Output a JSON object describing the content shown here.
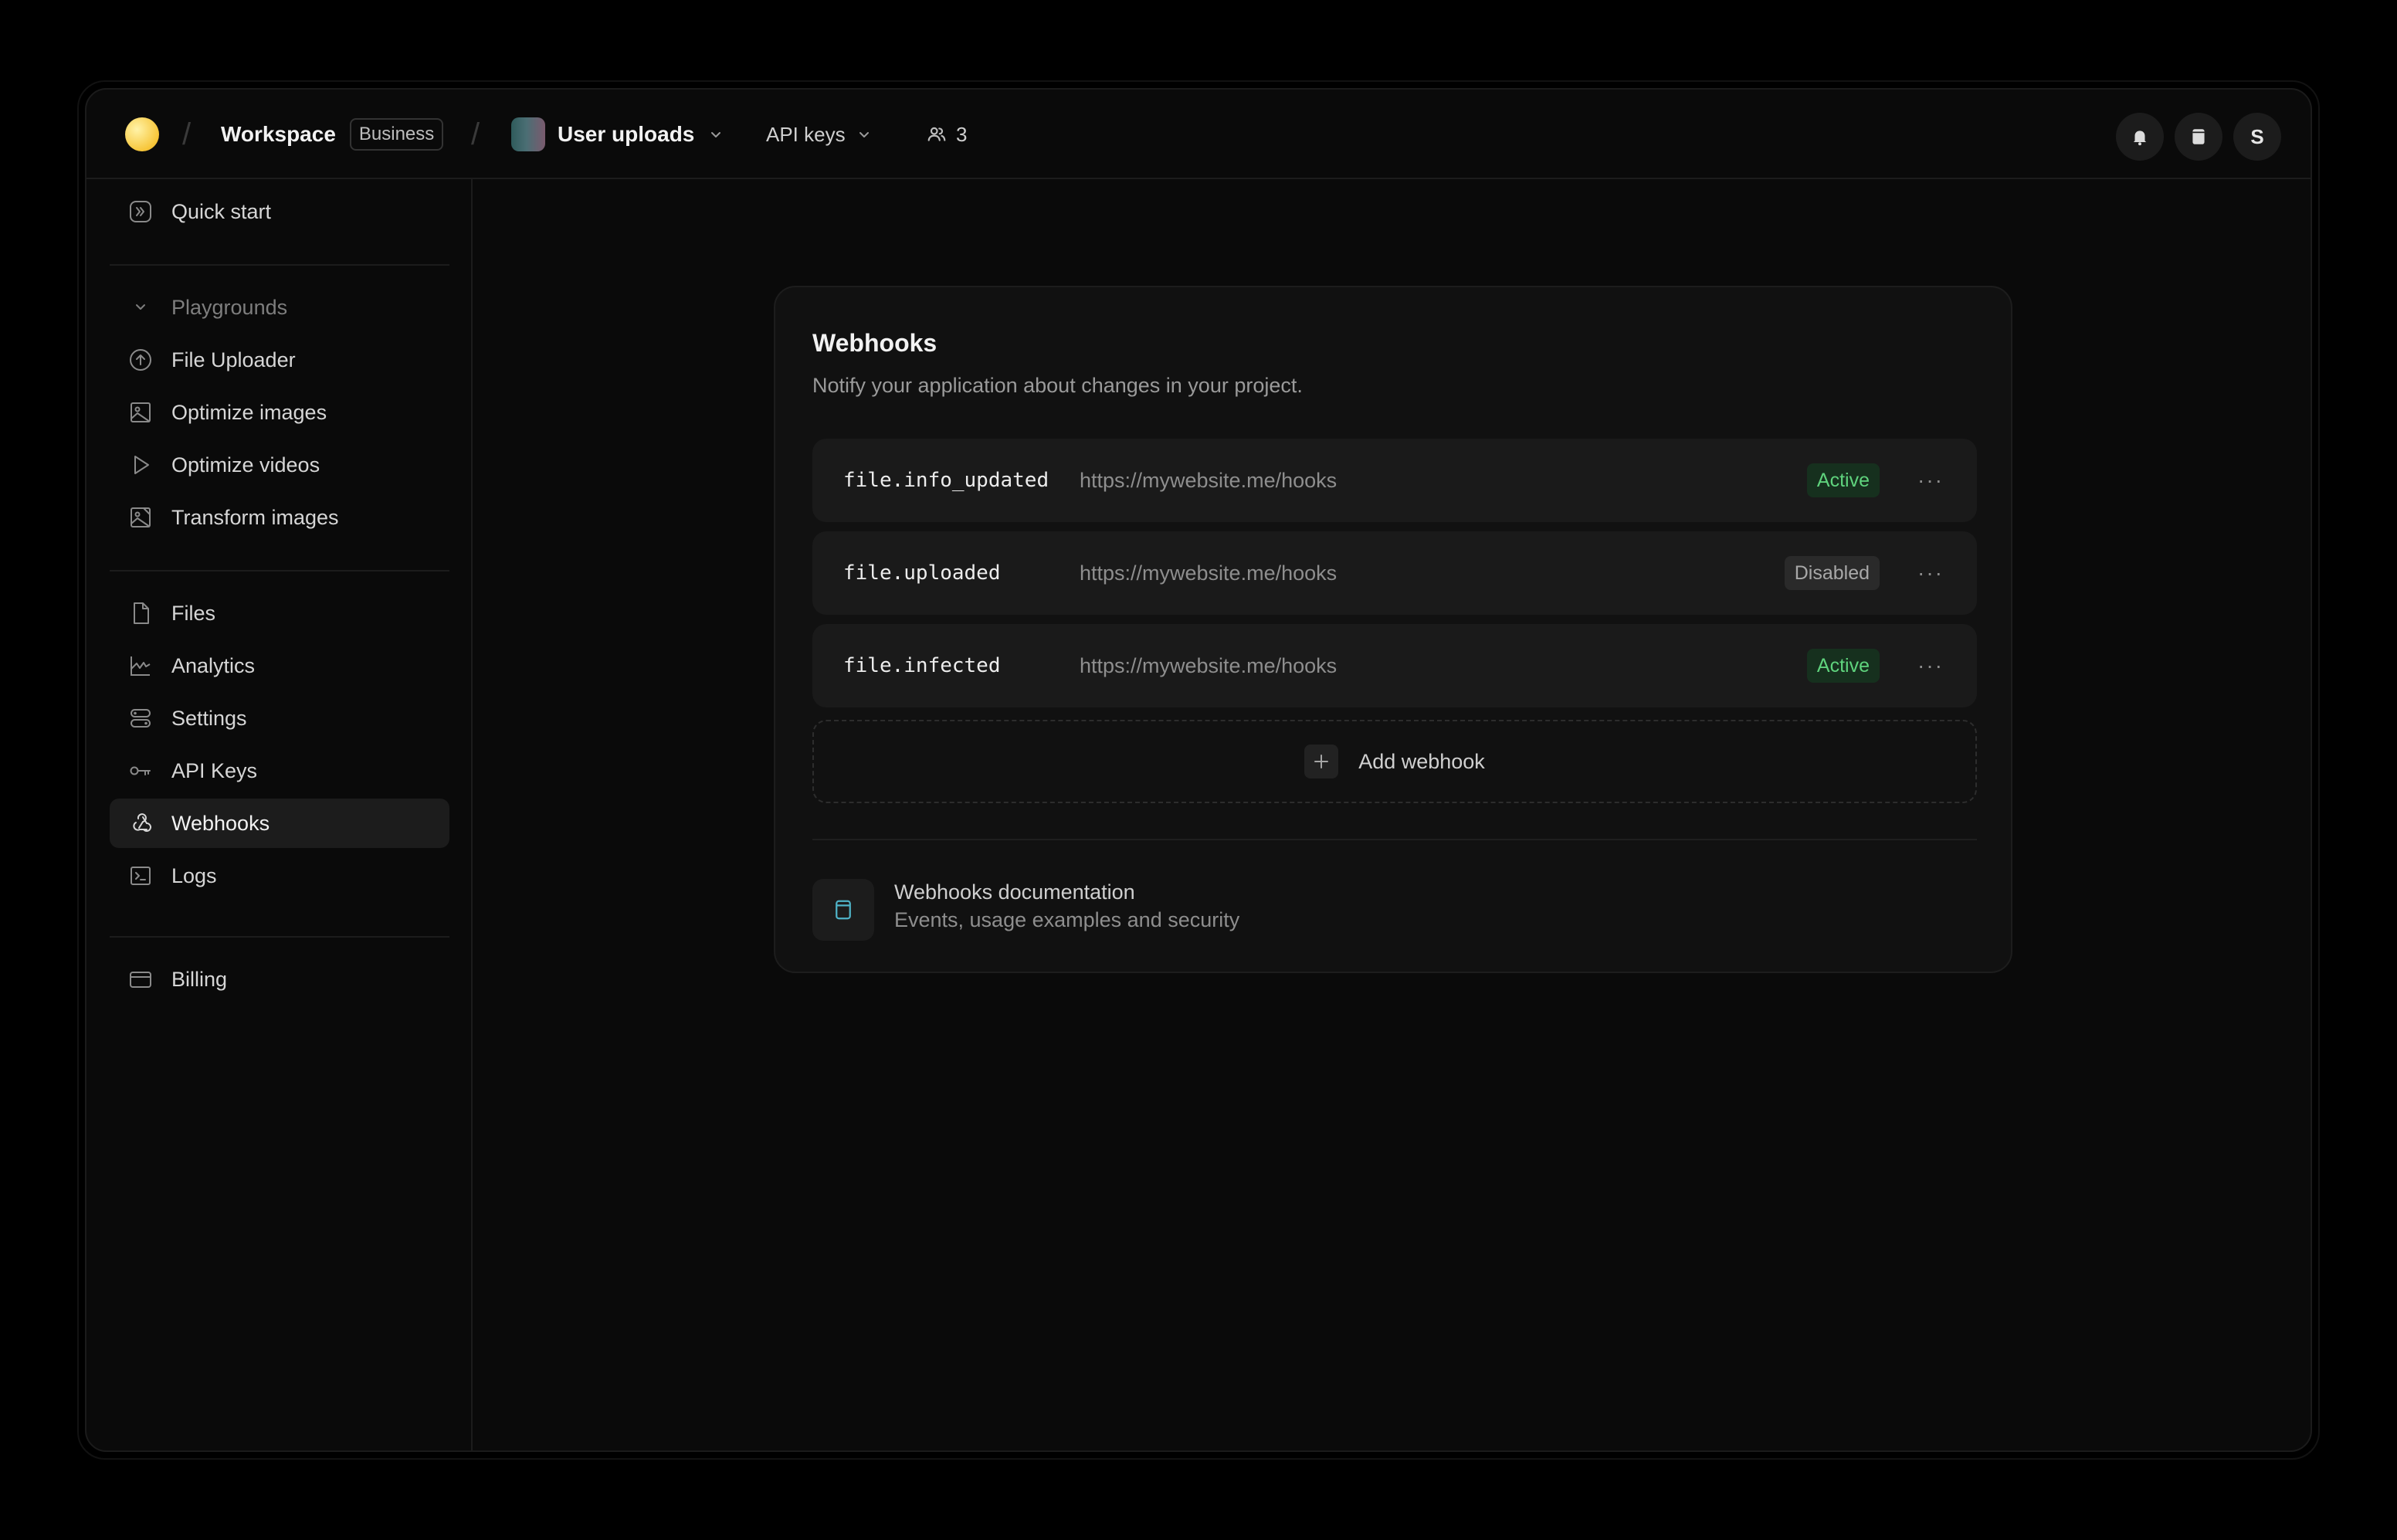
{
  "header": {
    "workspace_name": "Workspace",
    "plan_badge": "Business",
    "project_name": "User uploads",
    "api_keys_label": "API keys",
    "member_count": "3",
    "avatar_initial": "S",
    "icons": [
      "workspace-logo-icon",
      "project-icon",
      "chevron-down-icon",
      "users-icon",
      "bell-icon",
      "book-icon"
    ]
  },
  "sidebar": {
    "quick_start": "Quick start",
    "group_label": "Playgrounds",
    "playgrounds": [
      {
        "label": "File Uploader",
        "icon": "upload-icon"
      },
      {
        "label": "Optimize images",
        "icon": "image-icon"
      },
      {
        "label": "Optimize videos",
        "icon": "play-icon"
      },
      {
        "label": "Transform images",
        "icon": "transform-image-icon"
      }
    ],
    "items": [
      {
        "label": "Files",
        "icon": "file-icon"
      },
      {
        "label": "Analytics",
        "icon": "analytics-icon"
      },
      {
        "label": "Settings",
        "icon": "settings-icon"
      },
      {
        "label": "API Keys",
        "icon": "key-icon"
      },
      {
        "label": "Webhooks",
        "icon": "webhook-icon",
        "active": true
      },
      {
        "label": "Logs",
        "icon": "terminal-icon"
      }
    ],
    "billing": "Billing"
  },
  "webhooks": {
    "title": "Webhooks",
    "subtitle": "Notify your application about changes in your project.",
    "rows": [
      {
        "event": "file.info_updated",
        "url": "https://mywebsite.me/hooks",
        "status": "Active"
      },
      {
        "event": "file.uploaded",
        "url": "https://mywebsite.me/hooks",
        "status": "Disabled"
      },
      {
        "event": "file.infected",
        "url": "https://mywebsite.me/hooks",
        "status": "Active"
      }
    ],
    "more_label": "···",
    "add_label": "Add webhook",
    "docs_title": "Webhooks documentation",
    "docs_subtitle": "Events, usage examples and security"
  },
  "colors": {
    "background": "#0a0a0a",
    "card": "#111111",
    "row": "#1a1a1a",
    "active_text": "#5fd37d",
    "active_bg": "#16301e",
    "accent_doc_icon": "#4fb3c8"
  }
}
